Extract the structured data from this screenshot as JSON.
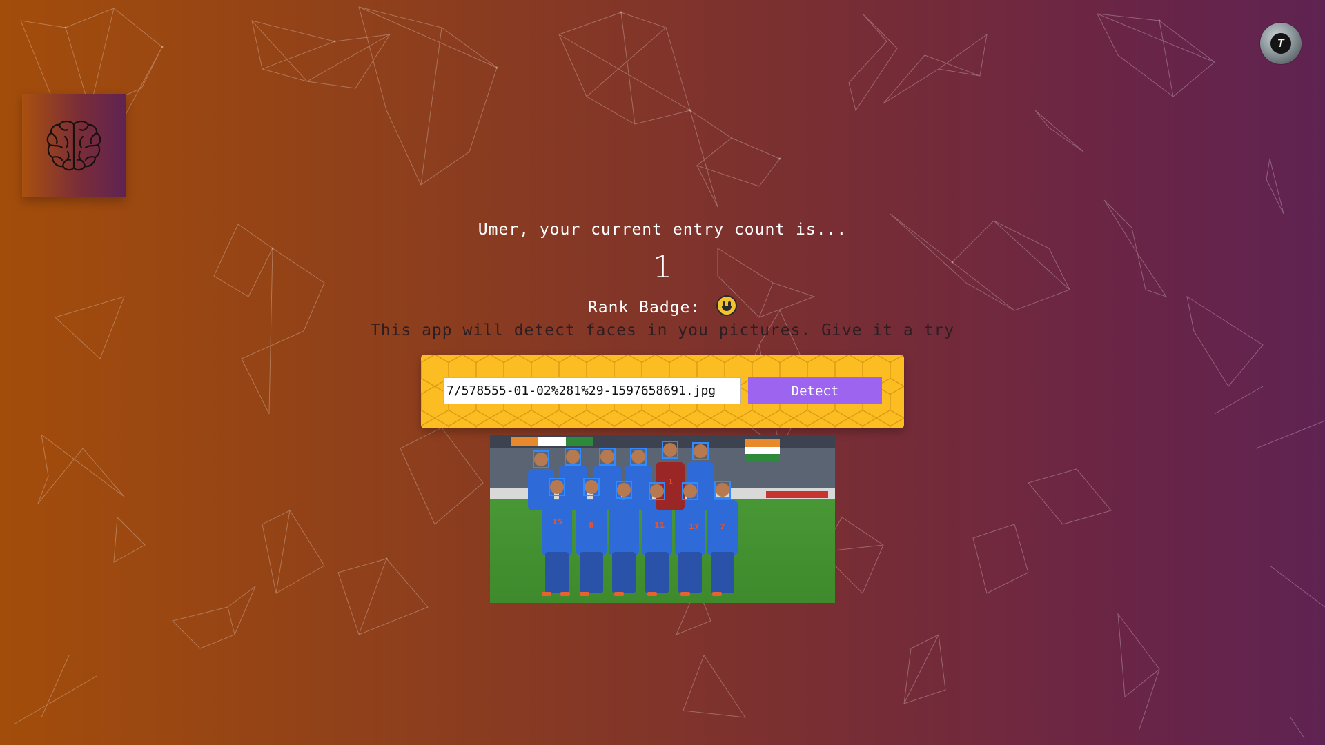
{
  "user": {
    "greeting": "Umer, your current entry count is...",
    "entry_count": "1",
    "rank_label": "Rank Badge:",
    "avatar_initial": "T"
  },
  "app": {
    "tagline": "This app will detect faces in you pictures. Give it a try"
  },
  "form": {
    "image_url_value": "7/578555-01-02%281%29-1597658691.jpg",
    "detect_label": "Detect"
  },
  "icons": {
    "logo": "brain-icon",
    "rank_badge": "grinning-face-emoji"
  },
  "photo": {
    "jersey_numbers": [
      "15",
      "8",
      "11",
      "17",
      "7",
      "1"
    ],
    "face_count": 11
  },
  "colors": {
    "panel": "#fbbd22",
    "button": "#9d64f0",
    "face_box": "#2f8bff"
  }
}
